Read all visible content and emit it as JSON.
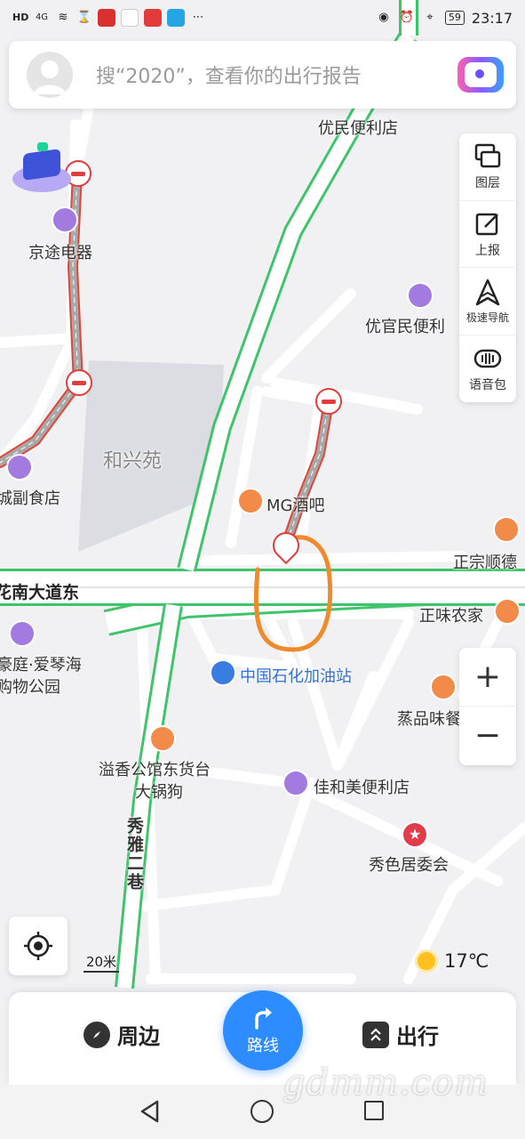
{
  "status_bar": {
    "time": "23:17",
    "battery": "59",
    "signal_label": "4G",
    "hd_label": "HD"
  },
  "search": {
    "placeholder": "搜“2020”，查看你的出行报告"
  },
  "tools": [
    {
      "label": "图层",
      "icon": "layers-icon"
    },
    {
      "label": "上报",
      "icon": "report-edit-icon"
    },
    {
      "label": "极速导航",
      "icon": "nav-arrow-icon"
    },
    {
      "label": "语音包",
      "icon": "voice-pack-icon"
    }
  ],
  "zoom": {
    "in": "+",
    "out": "−"
  },
  "map": {
    "scale": "20米",
    "weather_temp": "17℃",
    "pois": {
      "youmin": "优民便利店",
      "jingtu": "京途电器",
      "youguan": "优官民便利",
      "hexingyuan": "和兴苑",
      "fushidian": "城副食店",
      "mgbar": "MG酒吧",
      "zhengzong": "正宗顺德",
      "road_main": "花南大道东",
      "zhengwei": "正味农家",
      "haoting": "豪庭·爱琴海",
      "haoting2": "购物公园",
      "sinopec": "中国石化加油站",
      "zhengpin": "蒸品味餐",
      "yixiang": "溢香公馆东货台",
      "yixiang2": "大锅狗",
      "jiahemei": "佳和美便利店",
      "xiuya": "秀雅二巷",
      "xiuse": "秀色居委会"
    },
    "colors": {
      "road_green": "#3fc46b",
      "congestion": "#e0473a",
      "route_grey": "#a8a8a8",
      "poi_purple": "#a27ae0",
      "poi_orange": "#f28b4a",
      "poi_red": "#e23b4a",
      "poi_blue": "#3a7de0",
      "marker_orange": "#f08a2a"
    }
  },
  "bottom_bar": {
    "nearby": "周边",
    "route": "路线",
    "travel": "出行"
  },
  "watermark": "gdmm.com"
}
